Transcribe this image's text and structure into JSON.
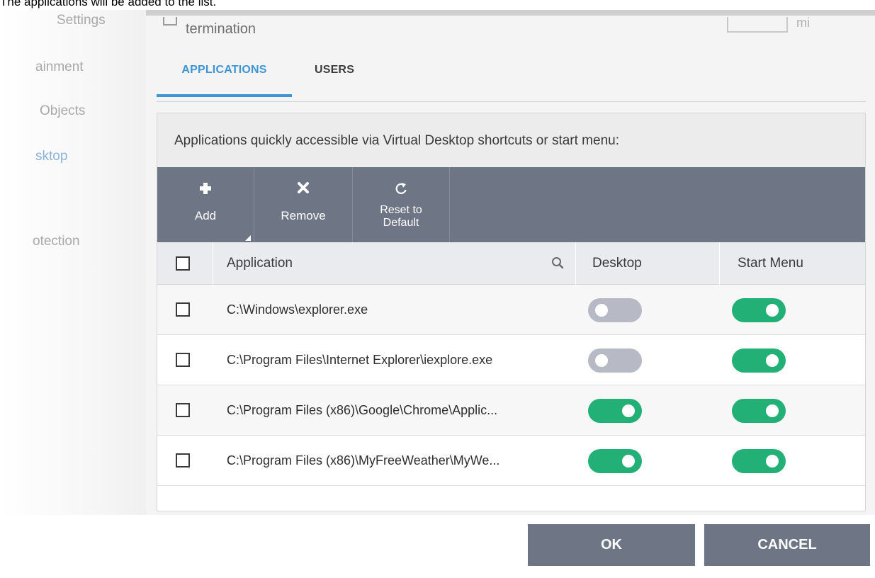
{
  "caption": "The applications will be added to the list.",
  "sidebar": {
    "items": [
      {
        "label": "Settings"
      },
      {
        "label": "ainment"
      },
      {
        "label": "Objects"
      },
      {
        "label": "sktop"
      },
      {
        "label": "otection"
      }
    ]
  },
  "header": {
    "checkbox_label": "termination",
    "right_text": "mi"
  },
  "tabs": [
    {
      "label": "APPLICATIONS",
      "active": true
    },
    {
      "label": "USERS",
      "active": false
    }
  ],
  "description": "Applications quickly accessible via Virtual Desktop shortcuts or start menu:",
  "toolbar": {
    "add": {
      "icon": "plus-icon",
      "label": "Add"
    },
    "remove": {
      "icon": "x-icon",
      "label": "Remove"
    },
    "reset": {
      "icon": "refresh-icon",
      "label_line1": "Reset to",
      "label_line2": "Default"
    }
  },
  "table": {
    "columns": [
      "Application",
      "Desktop",
      "Start Menu"
    ],
    "rows": [
      {
        "path": "C:\\Windows\\explorer.exe",
        "desktop": false,
        "start_menu": true
      },
      {
        "path": "C:\\Program Files\\Internet Explorer\\iexplore.exe",
        "desktop": false,
        "start_menu": true
      },
      {
        "path": "C:\\Program Files (x86)\\Google\\Chrome\\Applic...",
        "desktop": true,
        "start_menu": true
      },
      {
        "path": "C:\\Program Files (x86)\\MyFreeWeather\\MyWe...",
        "desktop": true,
        "start_menu": true
      }
    ]
  },
  "footer": {
    "ok": "OK",
    "cancel": "CANCEL"
  },
  "colors": {
    "accent": "#3e95d3",
    "toolbar": "#6e7685",
    "toggle_on": "#23b077",
    "toggle_off": "#b7bac4"
  }
}
